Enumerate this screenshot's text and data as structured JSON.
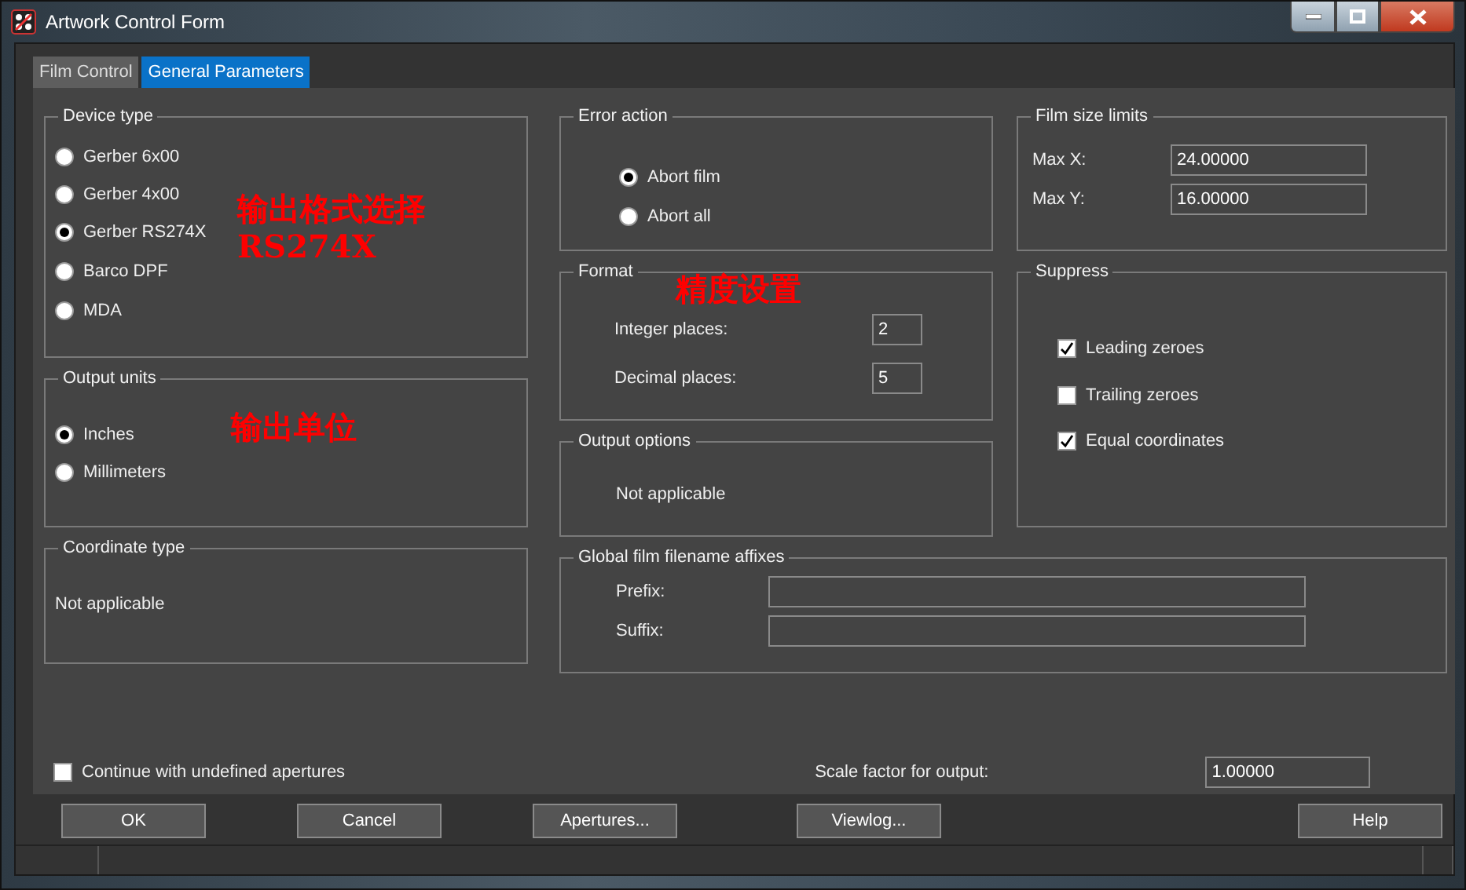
{
  "window": {
    "title": "Artwork Control Form"
  },
  "tabs": [
    {
      "label": "Film Control",
      "selected": false
    },
    {
      "label": "General Parameters",
      "selected": true
    }
  ],
  "device_type": {
    "legend": "Device type",
    "options": [
      {
        "label": "Gerber 6x00",
        "selected": false
      },
      {
        "label": "Gerber 4x00",
        "selected": false
      },
      {
        "label": "Gerber RS274X",
        "selected": true
      },
      {
        "label": "Barco DPF",
        "selected": false
      },
      {
        "label": "MDA",
        "selected": false
      }
    ],
    "annotation": [
      "输出格式选择",
      "RS274X"
    ]
  },
  "output_units": {
    "legend": "Output units",
    "options": [
      {
        "label": "Inches",
        "selected": true
      },
      {
        "label": "Millimeters",
        "selected": false
      }
    ],
    "annotation": [
      "输出单位"
    ]
  },
  "coordinate_type": {
    "legend": "Coordinate type",
    "text": "Not applicable"
  },
  "error_action": {
    "legend": "Error action",
    "options": [
      {
        "label": "Abort film",
        "selected": true
      },
      {
        "label": "Abort all",
        "selected": false
      }
    ]
  },
  "format": {
    "legend": "Format",
    "annotation": [
      "精度设置"
    ],
    "fields": [
      {
        "label": "Integer places:",
        "value": "2"
      },
      {
        "label": "Decimal places:",
        "value": "5"
      }
    ]
  },
  "output_options": {
    "legend": "Output options",
    "text": "Not applicable"
  },
  "film_size_limits": {
    "legend": "Film size limits",
    "fields": [
      {
        "label": "Max X:",
        "value": "24.00000"
      },
      {
        "label": "Max Y:",
        "value": "16.00000"
      }
    ]
  },
  "suppress": {
    "legend": "Suppress",
    "options": [
      {
        "label": "Leading zeroes",
        "checked": true
      },
      {
        "label": "Trailing zeroes",
        "checked": false
      },
      {
        "label": "Equal coordinates",
        "checked": true
      }
    ]
  },
  "affixes": {
    "legend": "Global film filename affixes",
    "fields": [
      {
        "label": "Prefix:"
      },
      {
        "label": "Suffix:"
      }
    ]
  },
  "continue_option": {
    "label": "Continue with undefined apertures",
    "checked": false
  },
  "scale_factor": {
    "label": "Scale factor for output:",
    "value": "1.00000"
  },
  "buttons": [
    "OK",
    "Cancel",
    "Apertures...",
    "Viewlog...",
    "Help"
  ]
}
